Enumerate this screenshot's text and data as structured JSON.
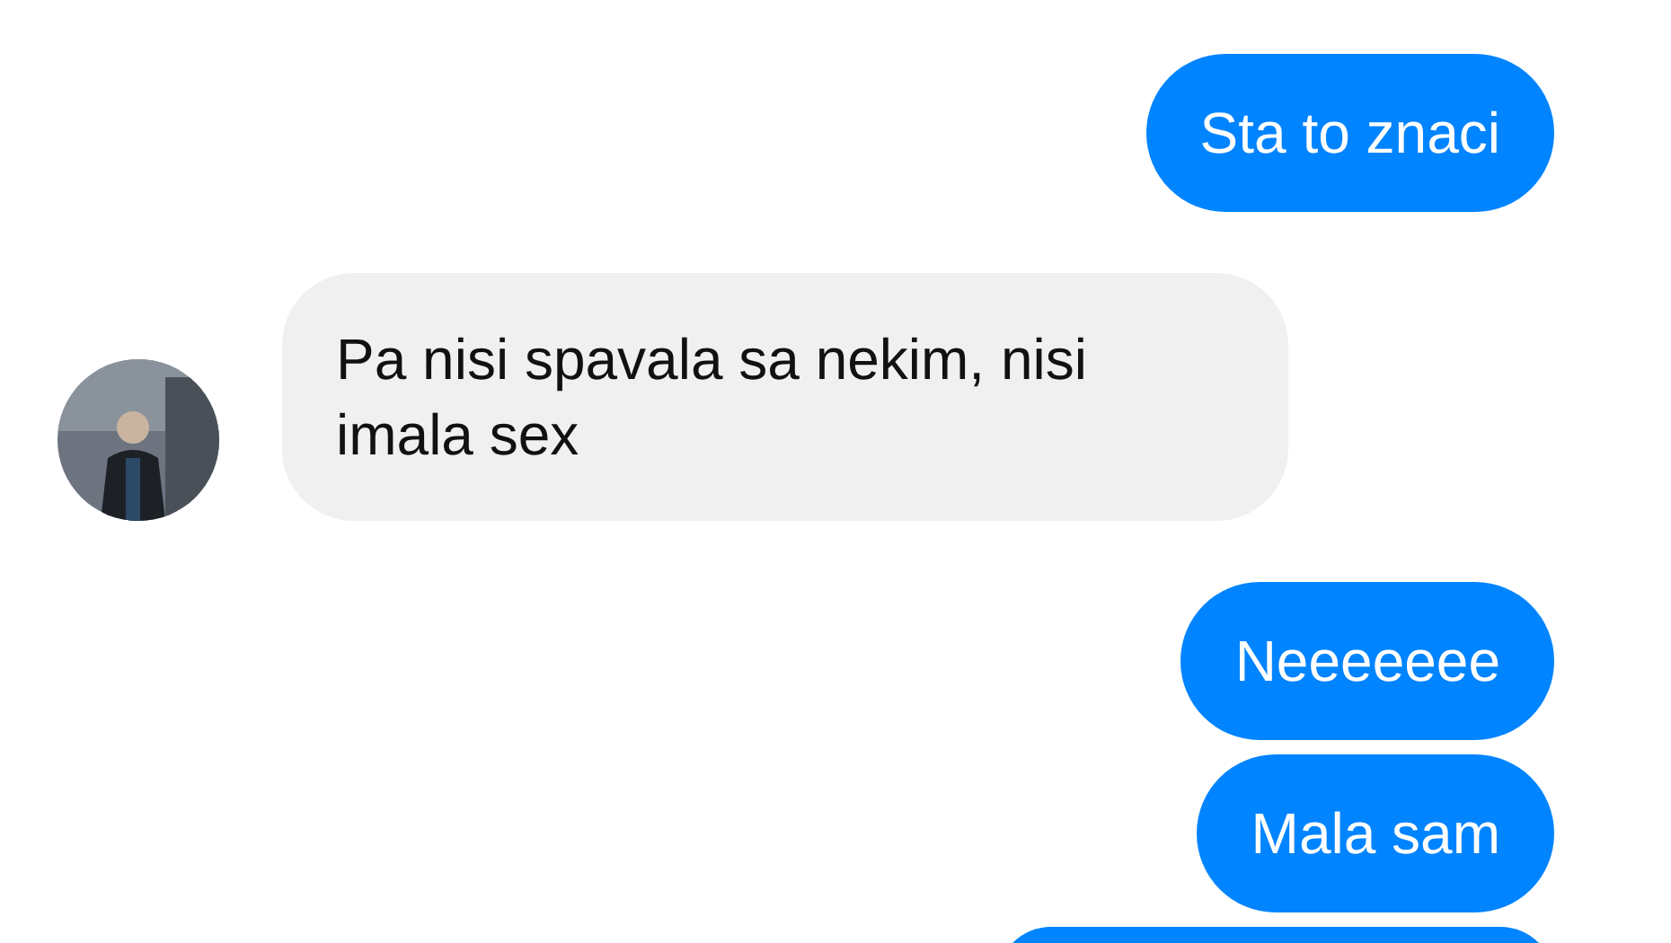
{
  "messages": [
    {
      "sent": true,
      "kind": "text",
      "text": "Sta to znaci"
    },
    {
      "sent": false,
      "kind": "text",
      "text": "Pa nisi spavala sa nekim, nisi imala sex"
    },
    {
      "sent": true,
      "kind": "text",
      "text": "Neeeeeee"
    },
    {
      "sent": true,
      "kind": "text",
      "text": "Mala sam"
    },
    {
      "sent": true,
      "kind": "cut"
    }
  ]
}
